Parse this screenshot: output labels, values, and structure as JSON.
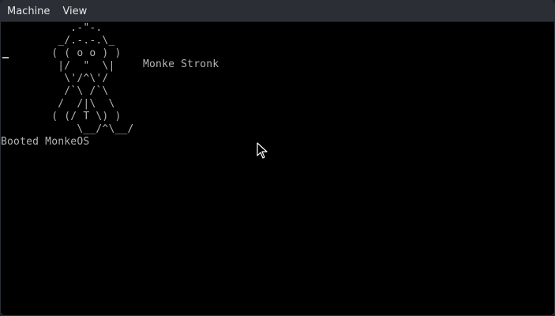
{
  "menubar": {
    "items": [
      {
        "label": "Machine"
      },
      {
        "label": "View"
      }
    ]
  },
  "terminal": {
    "ascii_art": "           .-\"-.\n         _/.-.-.\\_\n        ( ( o o ) )\n         |/  \"  \\|\n          \\'/^\\'/\n          /`\\ /`\\\n         /  /|\\  \\\n        ( (/ T \\) )\n            \\__/^\\__/",
    "caption": "Monke Stronk",
    "boot_message": "Booted MonkeOS"
  },
  "colors": {
    "screen_bg": "#000000",
    "text": "#b5b5b5",
    "menubar_bg": "#2b2f35",
    "menubar_text": "#e6e6e6"
  }
}
